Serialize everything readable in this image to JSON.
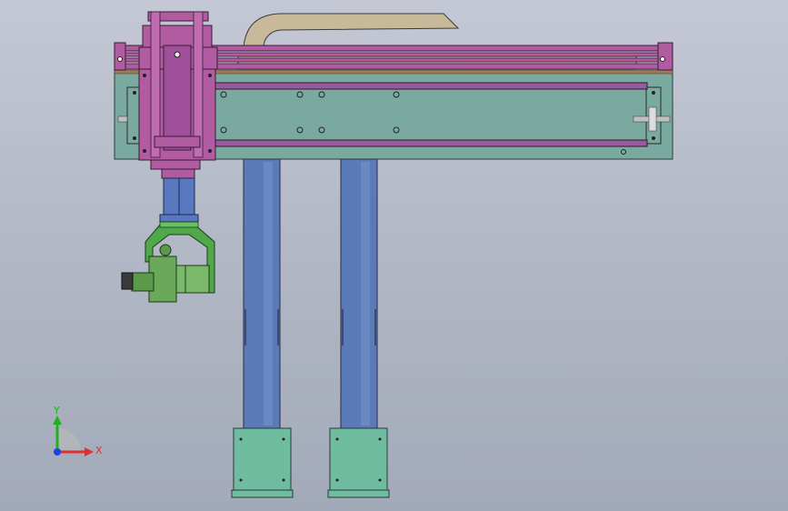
{
  "viewport": {
    "background_top": "#c4c8d4",
    "background_bottom": "#a2a9b8"
  },
  "triad": {
    "x_label": "X",
    "y_label": "Y",
    "x_color": "#e03030",
    "y_color": "#20b020",
    "z_color": "#2040e0"
  },
  "colors": {
    "frame_teal": "#7aa9a0",
    "slide_magenta": "#b15ca0",
    "rail_purple": "#9a5aa0",
    "column_blue": "#5a7ab8",
    "base_green": "#6fbca0",
    "gripper_green": "#4fa84a",
    "cable_tan": "#c8b99a",
    "cylinder_blue": "#5a78c0"
  },
  "icons": {
    "axis_triad": "coordinate-triad-icon"
  }
}
